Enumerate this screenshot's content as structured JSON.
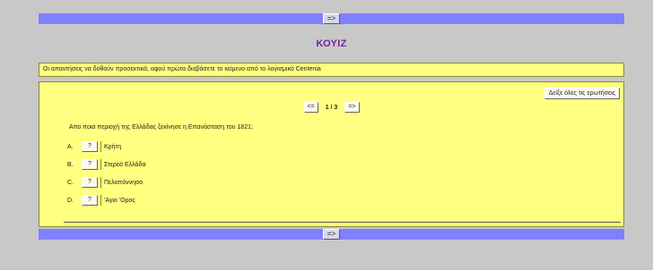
{
  "top_bar": {
    "next_label": "=>"
  },
  "title": "ΚΟΥΙΖ",
  "notice": "Οι απαντήσεις να δοθούν προσεκτικά, αφού πρώτα διαβάσετε το κείμενο από το λογισμικό Centenia",
  "show_all_label": "Δείξε όλες τις ερωτήσεις",
  "nav": {
    "prev_label": "<=",
    "page": "1 / 3",
    "next_label": "=>"
  },
  "question": "Απο ποια περιοχή της Ελλάδας ξεκίνησε η Επανάσταση του 1821;",
  "answers": [
    {
      "letter": "A.",
      "button": "?",
      "text": "Κρήτη"
    },
    {
      "letter": "B.",
      "button": "?",
      "text": "Στερεά Ελλάδα"
    },
    {
      "letter": "C.",
      "button": "?",
      "text": "Πελοπόννησο"
    },
    {
      "letter": "D.",
      "button": "?",
      "text": "'Αγιο 'Ορος"
    }
  ],
  "bottom_bar": {
    "next_label": "=>"
  },
  "colors": {
    "bar": "#8080ff",
    "panel": "#ffff80",
    "title": "#7a1fa2",
    "background": "#c8c8c8"
  }
}
